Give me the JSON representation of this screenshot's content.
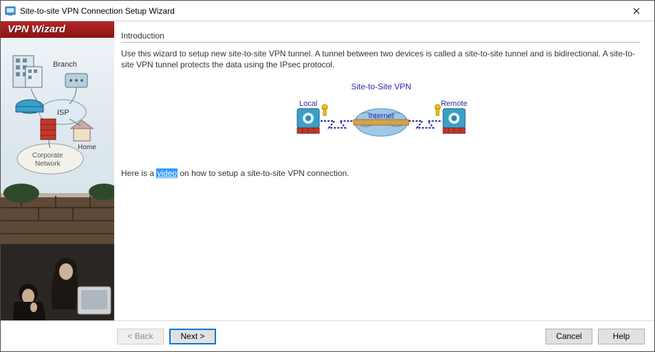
{
  "window": {
    "title": "Site-to-site VPN Connection Setup Wizard"
  },
  "sidebar": {
    "header": "VPN Wizard",
    "labels": {
      "branch": "Branch",
      "isp": "ISP",
      "home": "Home",
      "corp": "Corporate\nNetwork"
    }
  },
  "main": {
    "section_title": "Introduction",
    "intro_text": "Use this wizard to setup new site-to-site VPN tunnel. A tunnel between two devices is called a site-to-site tunnel and is bidirectional. A site-to-site VPN tunnel protects the data using the IPsec protocol.",
    "diagram": {
      "title": "Site-to-Site VPN",
      "local": "Local",
      "remote": "Remote",
      "internet": "Internet"
    },
    "video_prefix": "Here is a ",
    "video_link": "video",
    "video_suffix": " on how to setup a site-to-site VPN connection."
  },
  "footer": {
    "back": "< Back",
    "next": "Next >",
    "cancel": "Cancel",
    "help": "Help"
  }
}
